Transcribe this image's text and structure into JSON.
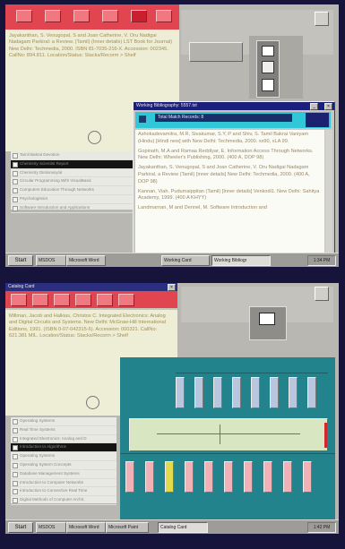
{
  "screen1": {
    "back_window": {
      "reference": "Jayakanthan, S. Venugopal, S and Joan Catherine, V. Oru Nadigai Nadagam Parkiral: a Review. (Tamil) (Inner details) LST Book for Journal) New Delhi: Techmedia, 2000. ISBN 81-7035-216-X. Accession: 002345. CallNo: 894.811. Location/Status: Stacks/Recorm > Shelf"
    },
    "list_items": [
      "Tamil Bakrai Devotion",
      "Chemistry Scientist Report",
      "Chemistry Distionary/al",
      "Circular Programming With VisualBasic",
      "Computers Education Through Networks",
      "Psychologistics",
      "Software Introduction and Applications"
    ],
    "selected_index": 1,
    "popup": {
      "title": "Working Bibliography: 5557.txt",
      "header": "Total Match Records: 8",
      "entries": [
        "Ashokadevamitra, M.R, Sivakumar, S.Y, P and Shiv, S. Tamil Bakrai Vaniyam (Hindu) [Hindi new] with New Delhi: Techmedia, 2000. xx90, xLA 99.",
        "Gopinath, M.A and Ramaa Reddiyar, E. Information Access Through Networks. New Delhi: Wheeler's Publishing, 2000. (400 A, DOP 98)",
        "Jayakanthan, S. Venugopal, S and Joan Catherine, V. Oru Nadigai Nadagam Parkiral, a Review (Tamil) [inner details] New Delhi: Techmedia, 2000. (400 A, DOP 98)",
        "Kannan, Viah. Pudumaippitan (Tamil) [Inner details] Venkodi1. New Delhi: Sahitya Academy, 1999. (400 A KHYY)",
        "Landmarnan, M and Dennel, M. Software Introduction and"
      ]
    },
    "taskbar": {
      "start": "Start",
      "buttons": [
        "MSDOS",
        "Microsoft Word",
        "Working Card",
        "Working Bibliogr"
      ],
      "active_index": 3,
      "clock": "1:34 PM"
    }
  },
  "screen2": {
    "title": "Catalog Card",
    "reference": "Millman, Jacob and Halkias, Christos C. Integrated Electronics: Analog and Digital Circuits and Systems. New Delhi: McGraw-Hill International Editions, 1991. (ISBN 0-07-042315-6). Accession: 000321. CallNo: 621.381 MIL. Location/Status: Stacks/Recorm > Shelf",
    "list_items": [
      "Operating Systems",
      "Real Time Systems",
      "Integrated Electronics: Analog and D",
      "Introduction to Algorithms",
      "Operating Systems",
      "Operating System Concepts",
      "Database Management Systems",
      "Introduction to Computer Networks",
      "Introduction to Connective Real Time",
      "Digital Methods of Computer Archit."
    ],
    "selected_index": 3,
    "shelf": {
      "top_row_color": "#b8c7dd",
      "bottom_row_colors": [
        "#f0b2b6",
        "#f0b2b6",
        "#e2da4a",
        "#f0b2b6",
        "#f0b2b6",
        "#f0b2b6",
        "#f0b2b6",
        "#f0b2b6",
        "#f0b2b6",
        "#f0b2b6"
      ],
      "background": "#23838d"
    },
    "taskbar": {
      "start": "Start",
      "buttons": [
        "MSDOS",
        "Microsoft Word",
        "Microsoft Paint",
        "Catalog Card"
      ],
      "active_index": 3,
      "clock": "1:42 PM"
    }
  }
}
